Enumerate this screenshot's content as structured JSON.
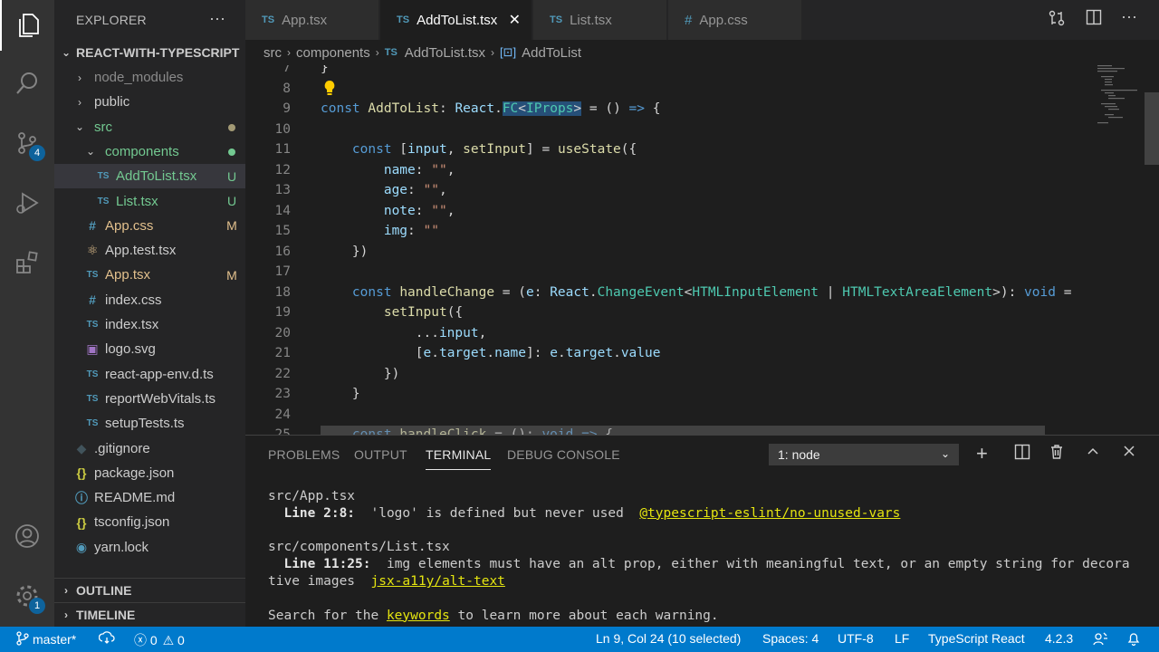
{
  "activity_bar": {
    "items": [
      {
        "icon": "files-icon"
      },
      {
        "icon": "search-icon"
      },
      {
        "icon": "source-control-icon",
        "badge": "4"
      },
      {
        "icon": "run-debug-icon"
      },
      {
        "icon": "extensions-icon"
      }
    ],
    "bottom": [
      {
        "icon": "account-icon"
      },
      {
        "icon": "settings-gear-icon",
        "badge": "1"
      }
    ]
  },
  "sidebar": {
    "title": "EXPLORER",
    "more": "···",
    "root": "REACT-WITH-TYPESCRIPT",
    "items": [
      {
        "label": "node_modules",
        "type": "folder",
        "collapsed": true,
        "color": "#8b8b8b"
      },
      {
        "label": "public",
        "type": "folder",
        "collapsed": true,
        "color": "#cccccc"
      },
      {
        "label": "src",
        "type": "folder",
        "collapsed": false,
        "color": "#73c991"
      },
      {
        "label": "components",
        "type": "folder",
        "collapsed": false,
        "color": "#73c991"
      },
      {
        "label": "AddToList.tsx",
        "type": "ts",
        "decoration": "U",
        "color": "#73c991"
      },
      {
        "label": "List.tsx",
        "type": "ts",
        "decoration": "U",
        "color": "#73c991"
      },
      {
        "label": "App.css",
        "type": "css",
        "decoration": "M",
        "color": "#e2c08d"
      },
      {
        "label": "App.test.tsx",
        "type": "react",
        "color": "#cccccc"
      },
      {
        "label": "App.tsx",
        "type": "ts",
        "decoration": "M",
        "color": "#e2c08d"
      },
      {
        "label": "index.css",
        "type": "css",
        "color": "#cccccc"
      },
      {
        "label": "index.tsx",
        "type": "ts",
        "color": "#cccccc"
      },
      {
        "label": "logo.svg",
        "type": "svg",
        "color": "#cccccc"
      },
      {
        "label": "react-app-env.d.ts",
        "type": "ts",
        "color": "#cccccc"
      },
      {
        "label": "reportWebVitals.ts",
        "type": "ts",
        "color": "#cccccc"
      },
      {
        "label": "setupTests.ts",
        "type": "ts",
        "color": "#cccccc"
      },
      {
        "label": ".gitignore",
        "type": "git",
        "color": "#cccccc"
      },
      {
        "label": "package.json",
        "type": "json",
        "color": "#cccccc"
      },
      {
        "label": "README.md",
        "type": "info",
        "color": "#cccccc"
      },
      {
        "label": "tsconfig.json",
        "type": "json",
        "color": "#cccccc"
      },
      {
        "label": "yarn.lock",
        "type": "yarn",
        "color": "#cccccc"
      }
    ],
    "outline": "OUTLINE",
    "timeline": "TIMELINE"
  },
  "tabs": [
    {
      "label": "App.tsx",
      "type": "ts"
    },
    {
      "label": "AddToList.tsx",
      "type": "ts",
      "active": true,
      "close": "✕"
    },
    {
      "label": "List.tsx",
      "type": "ts"
    },
    {
      "label": "App.css",
      "type": "css"
    }
  ],
  "ts_badge": "TS",
  "breadcrumb": {
    "parts": [
      "src",
      "components",
      "AddToList.tsx",
      "AddToList"
    ]
  },
  "editor": {
    "lines": [
      {
        "n": "7",
        "text": "}"
      },
      {
        "n": "8",
        "text": ""
      },
      {
        "n": "9",
        "text": "const AddToList: React.FC<IProps> = () => {"
      },
      {
        "n": "10",
        "text": ""
      },
      {
        "n": "11",
        "text": "    const [input, setInput] = useState({"
      },
      {
        "n": "12",
        "text": "        name: \"\","
      },
      {
        "n": "13",
        "text": "        age: \"\","
      },
      {
        "n": "14",
        "text": "        note: \"\","
      },
      {
        "n": "15",
        "text": "        img: \"\""
      },
      {
        "n": "16",
        "text": "    })"
      },
      {
        "n": "17",
        "text": ""
      },
      {
        "n": "18",
        "text": "    const handleChange = (e: React.ChangeEvent<HTMLInputElement | HTMLTextAreaElement>): void ="
      },
      {
        "n": "19",
        "text": "        setInput({"
      },
      {
        "n": "20",
        "text": "            ...input,"
      },
      {
        "n": "21",
        "text": "            [e.target.name]: e.target.value"
      },
      {
        "n": "22",
        "text": "        })"
      },
      {
        "n": "23",
        "text": "    }"
      },
      {
        "n": "24",
        "text": ""
      },
      {
        "n": "25",
        "text": "    const handleClick = (): void => {"
      }
    ]
  },
  "panel": {
    "tabs": [
      "PROBLEMS",
      "OUTPUT",
      "TERMINAL",
      "DEBUG CONSOLE"
    ],
    "active_tab": "TERMINAL",
    "terminal_select": "1: node",
    "terminal": {
      "file1": "src/App.tsx",
      "l1_pos": "  Line 2:8:",
      "l1_msg": "  'logo' is defined but never used  ",
      "l1_rule": "@typescript-eslint/no-unused-vars",
      "file2": "src/components/List.tsx",
      "l2_pos": "  Line 11:25:",
      "l2_msg": "  img elements must have an alt prop, either with meaningful text, or an empty string for decora",
      "l2_msg_cont": "tive images  ",
      "l2_rule": "jsx-a11y/alt-text",
      "hint_pre": "Search for the ",
      "hint_link": "keywords",
      "hint_post": " to learn more about each warning."
    }
  },
  "status_bar": {
    "branch": "master*",
    "errors": "0",
    "warnings": "0",
    "position": "Ln 9, Col 24 (10 selected)",
    "spaces": "Spaces: 4",
    "encoding": "UTF-8",
    "eol": "LF",
    "language": "TypeScript React",
    "version": "4.2.3"
  }
}
